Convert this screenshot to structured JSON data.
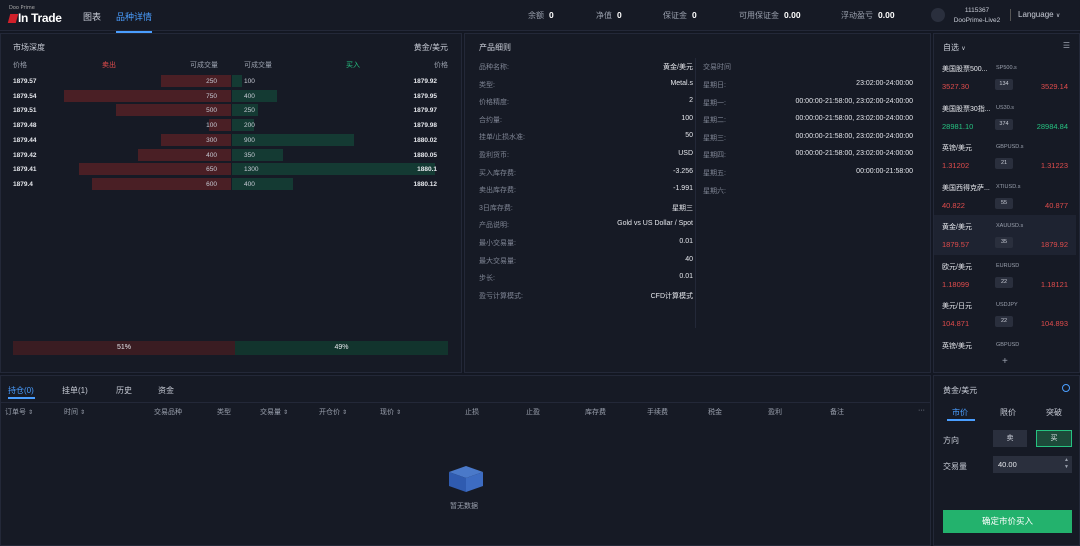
{
  "header": {
    "logo_small": "Doo Prime",
    "logo_big": "In Trade",
    "nav": [
      "图表",
      "品种详情"
    ],
    "stats": [
      {
        "label": "余额",
        "value": "0"
      },
      {
        "label": "净值",
        "value": "0"
      },
      {
        "label": "保证金",
        "value": "0"
      },
      {
        "label": "可用保证金",
        "value": "0.00"
      },
      {
        "label": "浮动盈亏",
        "value": "0.00"
      }
    ],
    "account_id": "1115367",
    "account_server": "DooPrime-Live2",
    "language": "Language"
  },
  "depth": {
    "title": "市场深度",
    "symbol": "黄金/美元",
    "headers": {
      "price": "价格",
      "sell": "卖出",
      "sell_vol": "可成交量",
      "buy_vol": "可成交量",
      "buy": "买入",
      "price2": "价格"
    },
    "rows": [
      {
        "bid": "1879.57",
        "sell_vol": "250",
        "buy_vol": "100",
        "ask": "1879.92",
        "sell_frac": 0.38,
        "buy_frac": 0.05
      },
      {
        "bid": "1879.54",
        "sell_vol": "750",
        "buy_vol": "400",
        "ask": "1879.95",
        "sell_frac": 0.9,
        "buy_frac": 0.22
      },
      {
        "bid": "1879.51",
        "sell_vol": "500",
        "buy_vol": "250",
        "ask": "1879.97",
        "sell_frac": 0.62,
        "buy_frac": 0.13
      },
      {
        "bid": "1879.48",
        "sell_vol": "100",
        "buy_vol": "200",
        "ask": "1879.98",
        "sell_frac": 0.12,
        "buy_frac": 0.11
      },
      {
        "bid": "1879.44",
        "sell_vol": "300",
        "buy_vol": "900",
        "ask": "1880.02",
        "sell_frac": 0.38,
        "buy_frac": 0.6
      },
      {
        "bid": "1879.42",
        "sell_vol": "400",
        "buy_vol": "350",
        "ask": "1880.05",
        "sell_frac": 0.5,
        "buy_frac": 0.25
      },
      {
        "bid": "1879.41",
        "sell_vol": "650",
        "buy_vol": "1300",
        "ask": "1880.1",
        "sell_frac": 0.82,
        "buy_frac": 1.0
      },
      {
        "bid": "1879.4",
        "sell_vol": "600",
        "buy_vol": "400",
        "ask": "1880.12",
        "sell_frac": 0.75,
        "buy_frac": 0.3
      }
    ],
    "sell_pct": "51%",
    "buy_pct": "49%"
  },
  "spec": {
    "title": "产品细则",
    "left": [
      {
        "k": "品种名称:",
        "v": "黄金/美元"
      },
      {
        "k": "类型:",
        "v": "Metal.s"
      },
      {
        "k": "价格精度:",
        "v": "2"
      },
      {
        "k": "合约量:",
        "v": "100"
      },
      {
        "k": "挂单/止损水准:",
        "v": "50"
      },
      {
        "k": "盈利货币:",
        "v": "USD"
      },
      {
        "k": "买入库存费:",
        "v": "-3.256"
      },
      {
        "k": "卖出库存费:",
        "v": "-1.991"
      },
      {
        "k": "3日库存费:",
        "v": "星期三"
      },
      {
        "k": "产品说明:",
        "v": "Gold vs US Dollar / Spot"
      },
      {
        "k": "最小交易量:",
        "v": "0.01"
      },
      {
        "k": "最大交易量:",
        "v": "40"
      },
      {
        "k": "步长:",
        "v": "0.01"
      },
      {
        "k": "盈亏计算模式:",
        "v": "CFD计算模式"
      }
    ],
    "right_title": "交易时间",
    "right": [
      {
        "k": "星期日:",
        "v": "23:02:00-24:00:00"
      },
      {
        "k": "星期一:",
        "v": "00:00:00-21:58:00, 23:02:00-24:00:00"
      },
      {
        "k": "星期二:",
        "v": "00:00:00-21:58:00, 23:02:00-24:00:00"
      },
      {
        "k": "星期三:",
        "v": "00:00:00-21:58:00, 23:02:00-24:00:00"
      },
      {
        "k": "星期四:",
        "v": "00:00:00-21:58:00, 23:02:00-24:00:00"
      },
      {
        "k": "星期五:",
        "v": "00:00:00-21:58:00"
      },
      {
        "k": "星期六:",
        "v": ""
      }
    ]
  },
  "watchlist": {
    "title": "自选",
    "items": [
      {
        "name": "美国股票500...",
        "sym": "SP500.s",
        "bid": "3527.30",
        "spread": "134",
        "ask": "3529.14",
        "bid_color": "red",
        "ask_color": "red"
      },
      {
        "name": "美国股票30指...",
        "sym": "US30.s",
        "bid": "28981.10",
        "spread": "374",
        "ask": "28984.84",
        "bid_color": "green",
        "ask_color": "green"
      },
      {
        "name": "英镑/美元",
        "sym": "GBPUSD.s",
        "bid": "1.31202",
        "spread": "21",
        "ask": "1.31223",
        "bid_color": "red",
        "ask_color": "red"
      },
      {
        "name": "美国西得克萨...",
        "sym": "XTIUSD.s",
        "bid": "40.822",
        "spread": "55",
        "ask": "40.877",
        "bid_color": "red",
        "ask_color": "red"
      },
      {
        "name": "黄金/美元",
        "sym": "XAUUSD.s",
        "bid": "1879.57",
        "spread": "35",
        "ask": "1879.92",
        "bid_color": "red",
        "ask_color": "red"
      },
      {
        "name": "欧元/美元",
        "sym": "EURUSD",
        "bid": "1.18099",
        "spread": "22",
        "ask": "1.18121",
        "bid_color": "red",
        "ask_color": "red"
      },
      {
        "name": "美元/日元",
        "sym": "USDJPY",
        "bid": "104.871",
        "spread": "22",
        "ask": "104.893",
        "bid_color": "red",
        "ask_color": "red"
      },
      {
        "name": "英镑/美元",
        "sym": "GBPUSD",
        "bid": "",
        "spread": "",
        "ask": "",
        "bid_color": "red",
        "ask_color": "red"
      }
    ],
    "add": "+"
  },
  "orders": {
    "tabs": [
      "持仓(0)",
      "挂单(1)",
      "历史",
      "资金"
    ],
    "columns": [
      "订单号",
      "时间",
      "交易品种",
      "类型",
      "交易量",
      "开仓价",
      "现价",
      "止损",
      "止盈",
      "库存费",
      "手续费",
      "税金",
      "盈利",
      "备注"
    ],
    "more": "···",
    "empty": "暂无数据"
  },
  "trade": {
    "title": "黄金/美元",
    "tabs": [
      "市价",
      "限价",
      "突破"
    ],
    "direction_label": "方向",
    "sell": "卖",
    "buy": "买",
    "volume_label": "交易量",
    "volume": "40.00",
    "submit": "确定市价买入"
  }
}
